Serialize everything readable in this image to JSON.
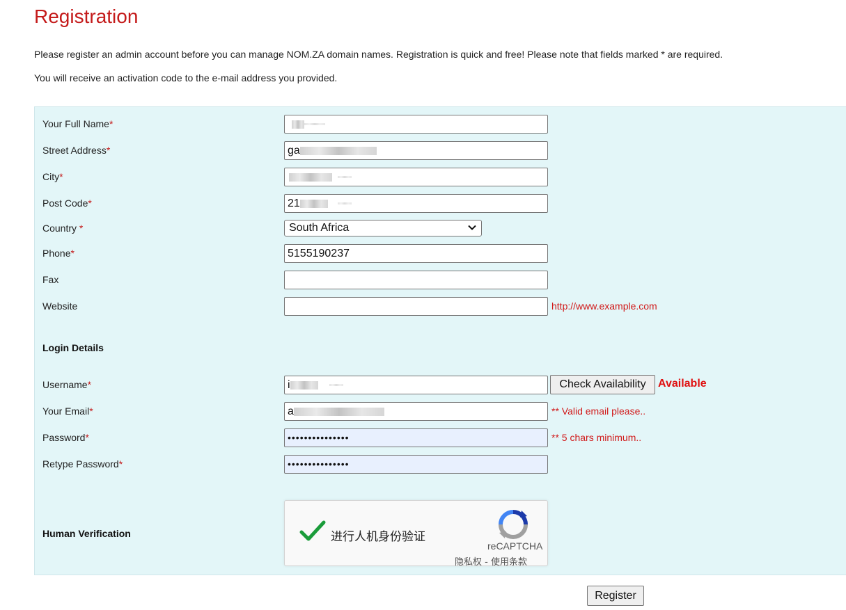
{
  "page": {
    "title": "Registration",
    "intro_line1": "Please register an admin account before you can manage NOM.ZA domain names. Registration is quick and free! Please note that fields marked * are required.",
    "intro_line2": "You will receive an activation code to the e-mail address you provided."
  },
  "form": {
    "required_mark": "*",
    "full_name": {
      "label": "Your Full Name",
      "value": ""
    },
    "street": {
      "label": "Street Address",
      "value": "ga"
    },
    "city": {
      "label": "City",
      "value": ""
    },
    "post_code": {
      "label": "Post Code",
      "value": "21"
    },
    "country": {
      "label": "Country ",
      "value": "South Africa"
    },
    "phone": {
      "label": "Phone",
      "value": "5155190237"
    },
    "fax": {
      "label": "Fax",
      "value": ""
    },
    "website": {
      "label": "Website",
      "value": "",
      "hint": "http://www.example.com"
    },
    "login_section": "Login Details",
    "username": {
      "label": "Username",
      "value": "i",
      "check_button": "Check Availability",
      "status": "Available"
    },
    "email": {
      "label": "Your Email",
      "value": "a",
      "hint": "** Valid email please.."
    },
    "password": {
      "label": "Password",
      "value": "•••••••••••••••",
      "hint": "** 5 chars minimum.."
    },
    "retype_password": {
      "label": "Retype Password",
      "value": "•••••••••••••••"
    },
    "human_section": "Human Verification",
    "captcha": {
      "text": "进行人机身份验证",
      "brand": "reCAPTCHA",
      "links": "隐私权 - 使用条款"
    },
    "register_button": "Register"
  },
  "colors": {
    "accent_red": "#c41a1a",
    "form_bg": "#e3f6f8",
    "autofill_bg": "#e8f0fe"
  },
  "icons": {
    "select_arrow": "chevron-down-icon",
    "captcha_check": "checkmark-icon",
    "captcha_logo": "recaptcha-logo-icon"
  }
}
